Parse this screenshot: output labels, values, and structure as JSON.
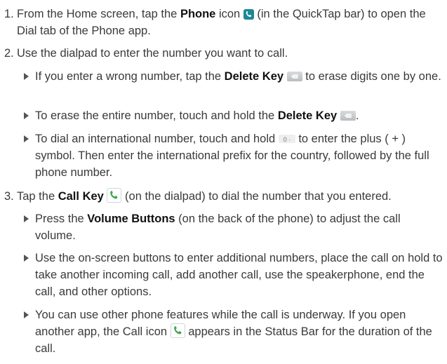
{
  "steps": [
    {
      "number": "1.",
      "parts": [
        "From the Home screen, tap the ",
        "Phone",
        " icon ",
        " (in the QuickTap bar) to open the Dial tab of the Phone app."
      ]
    },
    {
      "number": "2.",
      "parts": [
        "Use the dialpad to enter the number you want to call."
      ]
    },
    {
      "number": "3.",
      "parts": [
        "Tap the ",
        "Call Key",
        " ",
        " (on the dialpad) to dial the number that you entered."
      ]
    }
  ],
  "step2_bullets": [
    {
      "parts": [
        "If you enter a wrong number, tap the ",
        "Delete Key",
        " ",
        " to erase digits one by one."
      ]
    },
    {
      "parts": [
        "To erase the entire number, touch and hold the ",
        "Delete Key",
        " ",
        "."
      ]
    },
    {
      "parts": [
        "To dial an international number, touch and hold ",
        " to enter the plus ( + ) symbol. Then enter the international prefix for the country, followed by the full phone number."
      ]
    }
  ],
  "step3_bullets": [
    {
      "parts": [
        "Press the ",
        "Volume Buttons",
        " (on the back of the phone) to adjust the call volume."
      ]
    },
    {
      "parts": [
        "Use the on-screen buttons to enter additional numbers, place the call on hold to take another incoming call, add another call, use the speakerphone, end the call, and other options."
      ]
    },
    {
      "parts": [
        "You can use other phone features while the call is underway. If you open another app, the Call icon ",
        " appears in the Status Bar for the duration of the call."
      ]
    }
  ],
  "icons": {
    "phone": "phone-icon",
    "delete": "delete-key-icon",
    "zero": "zero-key-icon",
    "call": "call-key-icon"
  },
  "colors": {
    "text": "#3a3a3a",
    "bold": "#111111",
    "phone_icon": "#1c8a95",
    "call_icon": "#3aa64a"
  }
}
